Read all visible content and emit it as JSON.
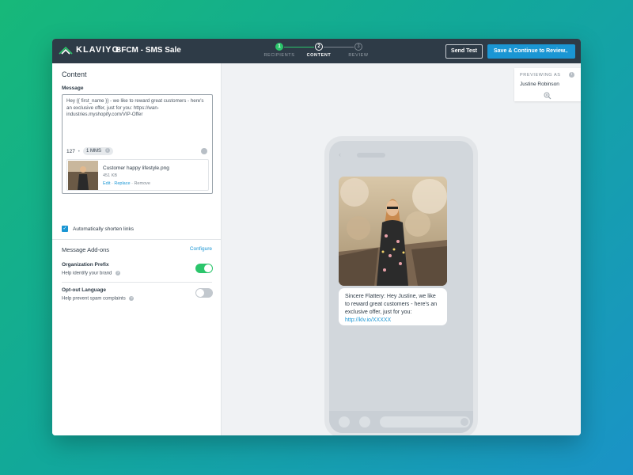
{
  "app": {
    "logo_text": "KLAVIYO",
    "campaign_title": "BFCM - SMS Sale"
  },
  "stepper": {
    "steps": [
      {
        "number": "1",
        "label": "RECIPIENTS",
        "state": "done"
      },
      {
        "number": "2",
        "label": "CONTENT",
        "state": "current"
      },
      {
        "number": "3",
        "label": "REVIEW",
        "state": "todo"
      }
    ]
  },
  "toolbar": {
    "send_test_label": "Send Test",
    "save_label": "Save & Continue to Review",
    "save_arrow": "→"
  },
  "content": {
    "section_title": "Content",
    "message_label": "Message",
    "message_text": "Hey {{ first_name }} - we like to reward great customers - here's an exclusive offer, just for you: https://wan-industries.myshopify.com/VIP-Offer",
    "char_count": "127",
    "separator": "•",
    "mms_badge": "1 MMS",
    "attachment": {
      "name": "Customer happy lifestyle.png",
      "size": "451 KB",
      "edit": "Edit",
      "replace": "Replace",
      "remove": "Remove"
    },
    "shorten_links_label": "Automatically shorten links",
    "shorten_links_checked": true
  },
  "addons": {
    "title": "Message Add-ons",
    "configure_label": "Configure",
    "items": [
      {
        "name": "Organization Prefix",
        "description": "Help identify your brand",
        "enabled": true
      },
      {
        "name": "Opt-out Language",
        "description": "Help prevent spam complaints",
        "enabled": false
      }
    ]
  },
  "preview": {
    "previewing_as_label": "PREVIEWING AS",
    "profile_name": "Justine Robinson",
    "bubble_text": "Sincere Flattery: Hey Justine, we like to reward great customers - here's an exclusive offer, just for you: ",
    "bubble_link": "http://klv.io/XXXXX"
  },
  "colors": {
    "topbar": "#2e3b47",
    "accent_blue": "#1a96d4",
    "success_green": "#2bc56b"
  },
  "icons": [
    "klaviyo-logo-icon",
    "info-icon",
    "emoji-icon",
    "check-icon",
    "help-icon",
    "zoom-in-icon",
    "arrow-right-icon",
    "back-chevron-icon"
  ]
}
